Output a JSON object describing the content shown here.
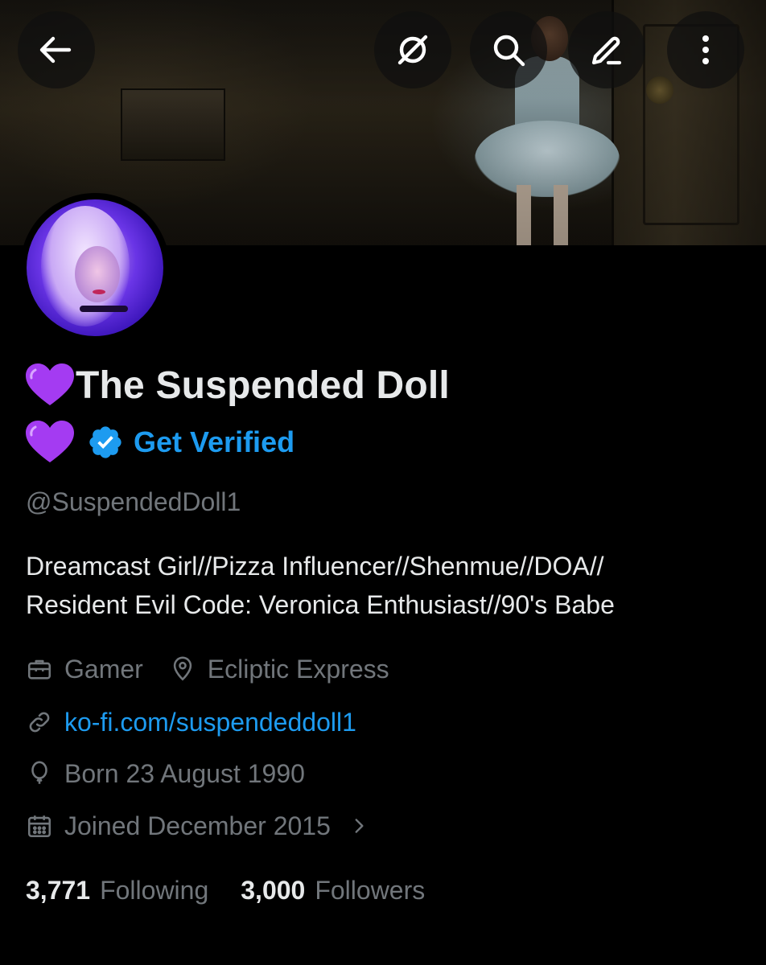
{
  "profile": {
    "display_name": "The Suspended Doll",
    "emoji": "💜",
    "get_verified_label": "Get Verified",
    "handle": "@SuspendedDoll1",
    "bio_line1": "Dreamcast Girl//Pizza Influencer//Shenmue//DOA//",
    "bio_line2": "Resident Evil Code: Veronica Enthusiast//90's Babe",
    "profession": "Gamer",
    "location": "Ecliptic Express",
    "website": "ko-fi.com/suspendeddoll1",
    "birthday": "Born 23 August 1990",
    "joined": "Joined December 2015"
  },
  "stats": {
    "following_count": "3,771",
    "following_label": "Following",
    "followers_count": "3,000",
    "followers_label": "Followers"
  },
  "nav": {
    "icons": [
      "back-arrow-icon",
      "grok-icon",
      "search-icon",
      "edit-pencil-icon",
      "more-vertical-icon"
    ]
  },
  "colors": {
    "background": "#000000",
    "primary_text": "#e7e9ea",
    "secondary_text": "#71767b",
    "accent": "#1d9bf0",
    "heart": "#a43bf2"
  }
}
